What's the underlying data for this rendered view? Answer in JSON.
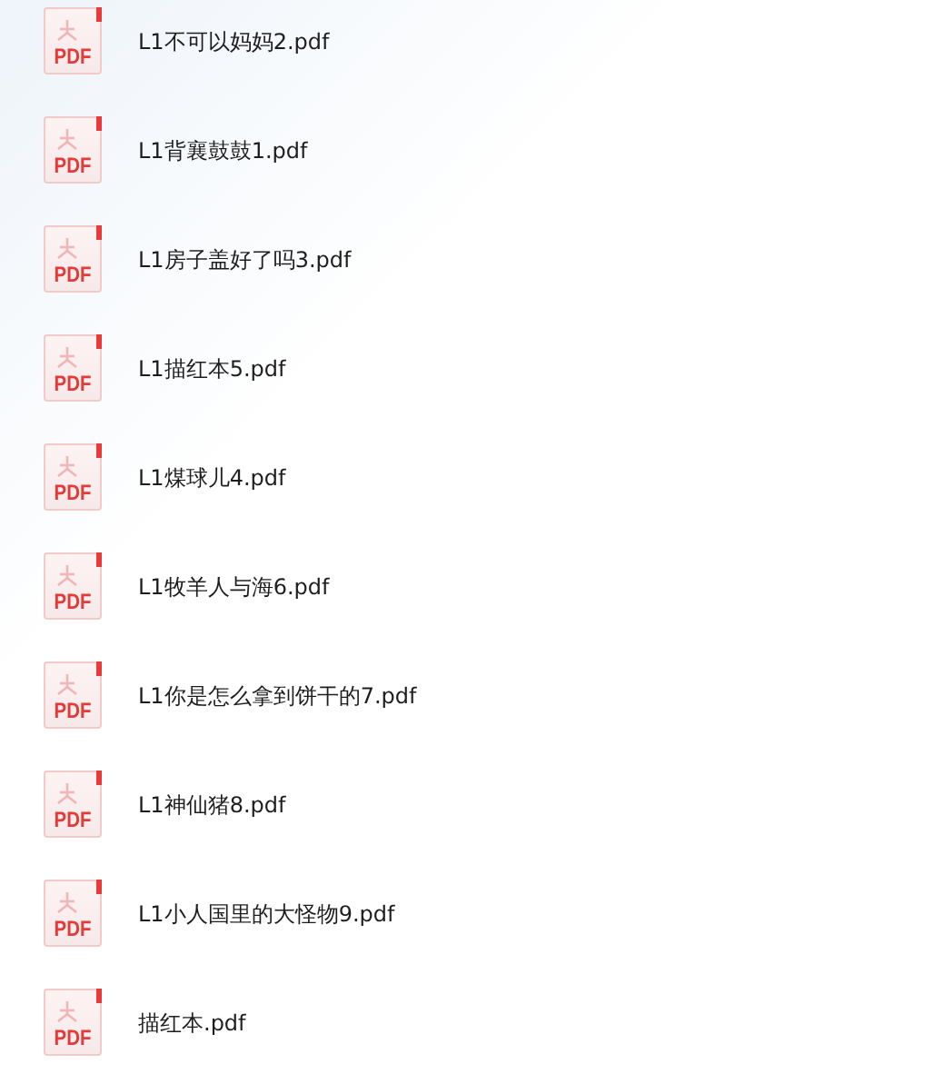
{
  "files": [
    {
      "name": "L1不可以妈妈2.pdf",
      "badge": "PDF"
    },
    {
      "name": "L1背襄鼓鼓1.pdf",
      "badge": "PDF"
    },
    {
      "name": "L1房子盖好了吗3.pdf",
      "badge": "PDF"
    },
    {
      "name": "L1描红本5.pdf",
      "badge": "PDF"
    },
    {
      "name": "L1煤球儿4.pdf",
      "badge": "PDF"
    },
    {
      "name": "L1牧羊人与海6.pdf",
      "badge": "PDF"
    },
    {
      "name": "L1你是怎么拿到饼干的7.pdf",
      "badge": "PDF"
    },
    {
      "name": "L1神仙猪8.pdf",
      "badge": "PDF"
    },
    {
      "name": "L1小人国里的大怪物9.pdf",
      "badge": "PDF"
    },
    {
      "name": "描红本.pdf",
      "badge": "PDF"
    }
  ]
}
